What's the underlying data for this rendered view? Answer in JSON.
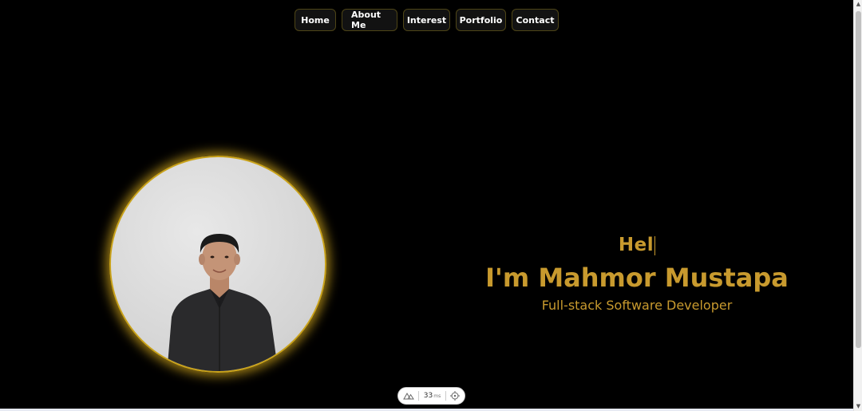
{
  "nav": {
    "items": [
      {
        "label": "Home"
      },
      {
        "label": "About Me"
      },
      {
        "label": "Interest"
      },
      {
        "label": "Portfolio"
      },
      {
        "label": "Contact"
      }
    ]
  },
  "hero": {
    "typing_text": "Hel",
    "name": "I'm Mahmor Mustapa",
    "role": "Full-stack Software Developer"
  },
  "devtools": {
    "icon": "nuxt-logo-icon",
    "time_value": "33",
    "time_unit": "ms",
    "inspect_icon": "crosshair-icon"
  },
  "colors": {
    "background": "#000000",
    "accent": "#c89a2e",
    "glow": "#d6aa1e",
    "nav_border": "#4e4517"
  },
  "portrait": {
    "icon": "profile-photo"
  }
}
